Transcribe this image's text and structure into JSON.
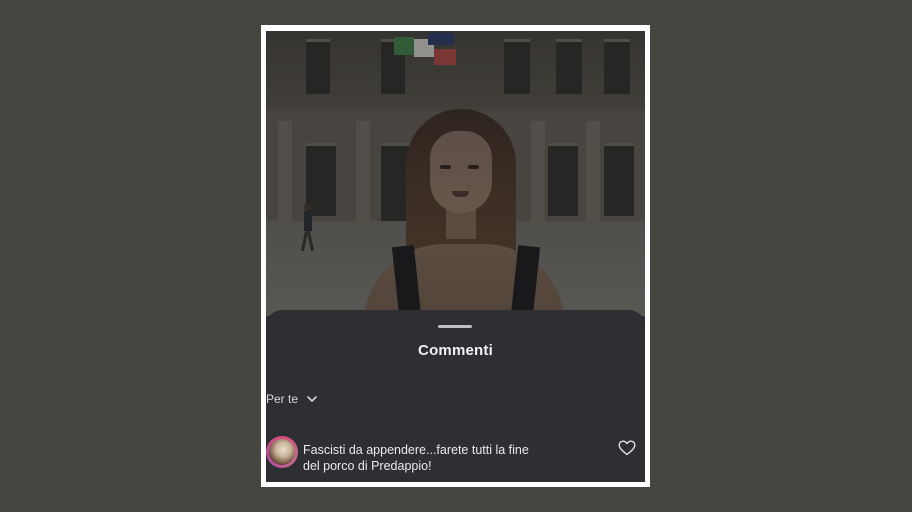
{
  "sheet": {
    "title": "Commenti",
    "sort_label": "Per te"
  },
  "comment": {
    "text_line1": "Fascisti da appendere...farete tutti la fine",
    "text_line2": "del porco di Predappio!"
  },
  "icons": {
    "sort": "chevron-down-icon",
    "like": "heart-icon"
  },
  "colors": {
    "background": "#46443f",
    "sheet": "#2d2f33",
    "avatar_ring": "#d94b7e",
    "text": "#eaeaea"
  }
}
